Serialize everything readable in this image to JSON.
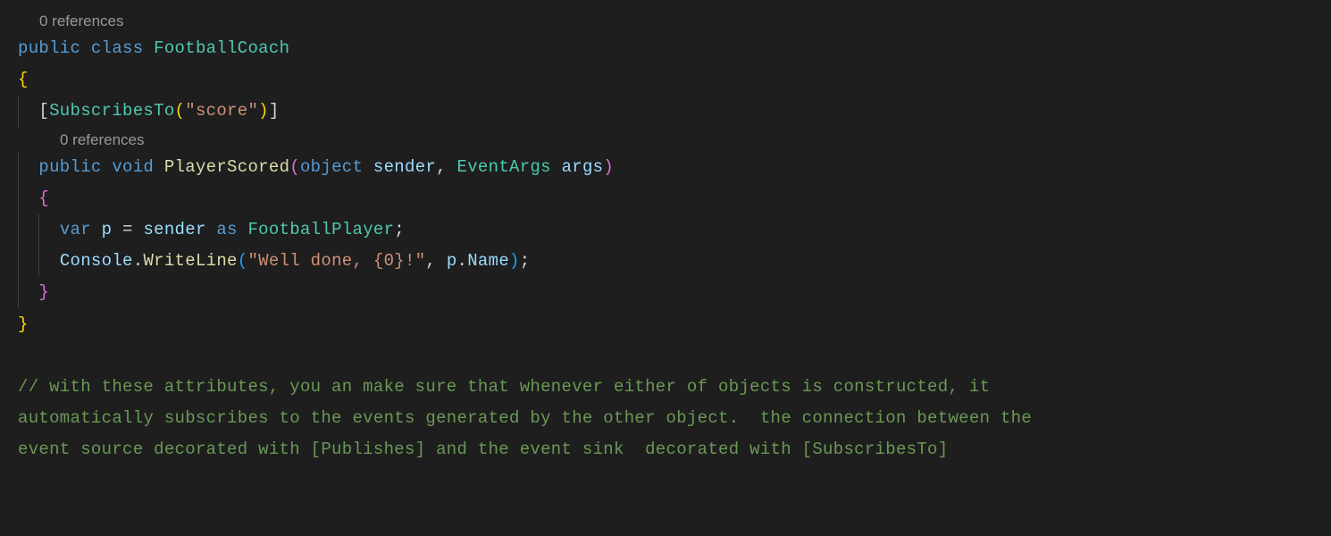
{
  "codelens": {
    "class_refs": "0 references",
    "method_refs": "0 references"
  },
  "code": {
    "kw_public": "public",
    "kw_class": "class",
    "kw_void": "void",
    "kw_object": "object",
    "kw_var": "var",
    "kw_as": "as",
    "type_footballcoach": "FootballCoach",
    "type_subscribesto": "SubscribesTo",
    "type_eventargs": "EventArgs",
    "type_footballplayer": "FootballPlayer",
    "method_playerscored": "PlayerScored",
    "method_writeline": "WriteLine",
    "var_sender": "sender",
    "var_args": "args",
    "var_p": "p",
    "var_console": "Console",
    "var_name": "Name",
    "str_score": "\"score\"",
    "str_welldone": "\"Well done, {0}!\"",
    "open_brace": "{",
    "close_brace": "}",
    "open_bracket": "[",
    "close_bracket": "]",
    "open_paren": "(",
    "close_paren": ")",
    "comma": ",",
    "dot": ".",
    "semicolon": ";",
    "equals": "=",
    "space": " "
  },
  "comment": {
    "line1": "// with these attributes, you an make sure that whenever either of objects is constructed, it ",
    "line2": "automatically subscribes to the events generated by the other object.  the connection between the ",
    "line3": "event source decorated with [Publishes] and the event sink  decorated with [SubscribesTo]"
  }
}
